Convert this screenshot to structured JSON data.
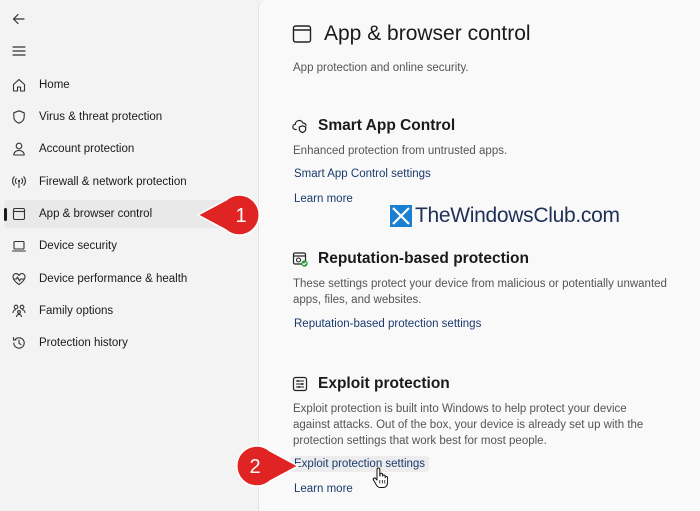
{
  "sidebar": {
    "items": [
      {
        "label": "Home",
        "icon": "home-icon"
      },
      {
        "label": "Virus & threat protection",
        "icon": "shield-icon"
      },
      {
        "label": "Account protection",
        "icon": "person-icon"
      },
      {
        "label": "Firewall & network protection",
        "icon": "antenna-icon"
      },
      {
        "label": "App & browser control",
        "icon": "app-window-icon",
        "selected": true
      },
      {
        "label": "Device security",
        "icon": "laptop-icon"
      },
      {
        "label": "Device performance & health",
        "icon": "heart-pulse-icon"
      },
      {
        "label": "Family options",
        "icon": "family-icon"
      },
      {
        "label": "Protection history",
        "icon": "history-icon"
      }
    ]
  },
  "main": {
    "title": "App & browser control",
    "subtitle": "App protection and online security.",
    "sections": [
      {
        "title": "Smart App Control",
        "icon": "cloud-shield-icon",
        "description": "Enhanced protection from untrusted apps.",
        "links": [
          "Smart App Control settings",
          "Learn more"
        ]
      },
      {
        "title": "Reputation-based protection",
        "icon": "reputation-icon",
        "description_lines": [
          "These settings protect your device from malicious or potentially unwanted",
          "apps, files, and websites."
        ],
        "links": [
          "Reputation-based protection settings"
        ]
      },
      {
        "title": "Exploit protection",
        "icon": "exploit-icon",
        "description_lines": [
          "Exploit protection is built into Windows to help protect your device",
          "against attacks. Out of the box, your device is already set up with the",
          "protection settings that work best for most people."
        ],
        "links": [
          "Exploit protection settings",
          "Learn more"
        ]
      }
    ]
  },
  "callouts": [
    {
      "number": "1"
    },
    {
      "number": "2"
    }
  ],
  "watermark": {
    "text": "TheWindowsClub.com"
  },
  "colors": {
    "callout": "#e02424",
    "link": "#1a3a6e",
    "selected_bg": "#e9e9e9"
  }
}
